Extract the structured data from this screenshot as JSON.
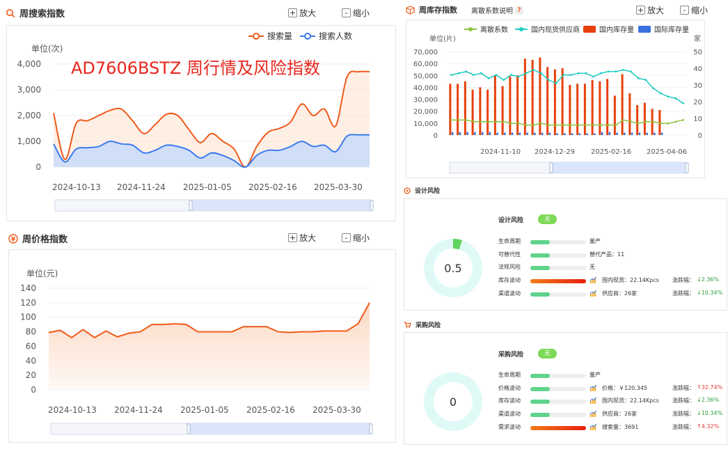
{
  "overlay_title": "AD7606BSTZ 周行情及风险指数",
  "controls": {
    "zoom_in": "放大",
    "zoom_out": "缩小",
    "plus": "+",
    "minus": "-"
  },
  "search_panel": {
    "title": "周搜索指数",
    "unit": "单位(次)",
    "legend": [
      "搜索量",
      "搜索人数"
    ],
    "y_ticks": [
      "4,000",
      "3,000",
      "2,000",
      "1,000",
      "0"
    ],
    "x_ticks": [
      "2024-10-13",
      "2024-11-24",
      "2025-01-05",
      "2025-02-16",
      "2025-03-30"
    ]
  },
  "price_panel": {
    "title": "周价格指数",
    "unit": "单位(元)",
    "y_ticks": [
      "140",
      "120",
      "100",
      "80",
      "60",
      "40",
      "20",
      "0"
    ],
    "x_ticks": [
      "2024-10-13",
      "2024-11-24",
      "2025-01-05",
      "2025-02-16",
      "2025-03-30"
    ]
  },
  "inventory_panel": {
    "title": "周库存指数",
    "help_label": "离散系数说明",
    "help_icon": "?",
    "legend": [
      "离散系数",
      "国内现货供应商",
      "国内库存量",
      "国际库存量"
    ],
    "unit_left": "单位(片)",
    "unit_right": "家",
    "y_ticks_left": [
      "70,000",
      "60,000",
      "50,000",
      "40,000",
      "30,000",
      "20,000",
      "10,000",
      "0"
    ],
    "y_ticks_right": [
      "50",
      "40",
      "30",
      "20",
      "10",
      "0"
    ],
    "x_ticks": [
      "2024-11-10",
      "2024-12-29",
      "2025-02-16",
      "2025-04-06"
    ]
  },
  "design_risk": {
    "section_title": "设计风险",
    "score": "0.5",
    "header_label": "设计风险",
    "header_badge": "无",
    "rows": [
      {
        "label": "生命周期",
        "value": "量产",
        "change_label": "",
        "change": ""
      },
      {
        "label": "可替代性",
        "value": "替代产品：11",
        "change_label": "",
        "change": ""
      },
      {
        "label": "法规风险",
        "value": "无",
        "change_label": "",
        "change": ""
      },
      {
        "label": "库存波动",
        "value": "国内现货：22.14Kpcs",
        "change_label": "涨跌幅：",
        "change": "↓2.36%"
      },
      {
        "label": "渠道波动",
        "value": "供应商：26家",
        "change_label": "涨跌幅：",
        "change": "↓10.34%"
      }
    ]
  },
  "purchase_risk": {
    "section_title": "采购风险",
    "score": "0",
    "header_label": "采购风险",
    "header_badge": "无",
    "rows": [
      {
        "label": "生命周期",
        "value": "量产",
        "change_label": "",
        "change": ""
      },
      {
        "label": "价格波动",
        "value": "价格：￥120.345",
        "change_label": "涨跌幅：",
        "change": "↑32.74%"
      },
      {
        "label": "库存波动",
        "value": "国内现货：22.14Kpcs",
        "change_label": "涨跌幅：",
        "change": "↓2.36%"
      },
      {
        "label": "渠道波动",
        "value": "供应商：26家",
        "change_label": "涨跌幅：",
        "change": "↓10.34%"
      },
      {
        "label": "需求波动",
        "value": "搜索量：3691",
        "change_label": "涨跌幅：",
        "change": "↑4.32%"
      }
    ]
  },
  "colors": {
    "orange": "#f05a1a",
    "blue": "#3a7bef",
    "green": "#8cc63f",
    "teal": "#1ccbbf",
    "down": "#2e9e3e",
    "up": "#e53935",
    "title_red": "#e8261e"
  },
  "chart_data": [
    {
      "type": "line",
      "title": "周搜索指数",
      "ylabel": "单位(次)",
      "ylim": [
        0,
        4000
      ],
      "x": [
        "2024-09-29",
        "2024-10-06",
        "2024-10-13",
        "2024-10-20",
        "2024-10-27",
        "2024-11-03",
        "2024-11-10",
        "2024-11-17",
        "2024-11-24",
        "2024-12-01",
        "2024-12-08",
        "2024-12-15",
        "2024-12-22",
        "2024-12-29",
        "2025-01-05",
        "2025-01-12",
        "2025-01-19",
        "2025-01-26",
        "2025-02-02",
        "2025-02-09",
        "2025-02-16",
        "2025-02-23",
        "2025-03-02",
        "2025-03-09",
        "2025-03-16",
        "2025-03-23",
        "2025-03-30",
        "2025-04-06",
        "2025-04-13"
      ],
      "series": [
        {
          "name": "搜索量",
          "values": [
            2100,
            300,
            1700,
            1800,
            2000,
            2200,
            2250,
            1800,
            1300,
            1650,
            2050,
            2000,
            1450,
            950,
            1300,
            1000,
            700,
            0,
            800,
            1350,
            1500,
            1750,
            2450,
            2000,
            2250,
            1600,
            3500,
            3700,
            3700
          ]
        },
        {
          "name": "搜索人数",
          "values": [
            900,
            200,
            700,
            750,
            800,
            1000,
            900,
            850,
            550,
            650,
            850,
            800,
            650,
            350,
            550,
            450,
            250,
            0,
            450,
            650,
            650,
            800,
            1000,
            800,
            850,
            600,
            1200,
            1250,
            1250
          ]
        }
      ]
    },
    {
      "type": "area",
      "title": "周价格指数",
      "ylabel": "单位(元)",
      "ylim": [
        0,
        140
      ],
      "x": [
        "2024-09-29",
        "2024-10-06",
        "2024-10-13",
        "2024-10-20",
        "2024-10-27",
        "2024-11-03",
        "2024-11-10",
        "2024-11-17",
        "2024-11-24",
        "2024-12-01",
        "2024-12-08",
        "2024-12-15",
        "2024-12-22",
        "2024-12-29",
        "2025-01-05",
        "2025-01-12",
        "2025-01-19",
        "2025-01-26",
        "2025-02-02",
        "2025-02-09",
        "2025-02-16",
        "2025-02-23",
        "2025-03-02",
        "2025-03-09",
        "2025-03-16",
        "2025-03-23",
        "2025-03-30",
        "2025-04-06",
        "2025-04-13"
      ],
      "series": [
        {
          "values": [
            79,
            82,
            72,
            83,
            72,
            81,
            73,
            78,
            80,
            90,
            90,
            91,
            90,
            80,
            80,
            80,
            80,
            87,
            87,
            87,
            80,
            79,
            80,
            80,
            81,
            81,
            81,
            91,
            120
          ]
        }
      ]
    },
    {
      "type": "bar",
      "title": "周库存指数",
      "ylabel": "单位(片)",
      "ylim": [
        0,
        70000
      ],
      "y2lim": [
        0,
        50
      ],
      "x": [
        "2024-10-13",
        "2024-10-20",
        "2024-10-27",
        "2024-11-03",
        "2024-11-10",
        "2024-11-17",
        "2024-11-24",
        "2024-12-01",
        "2024-12-08",
        "2024-12-15",
        "2024-12-22",
        "2024-12-29",
        "2025-01-05",
        "2025-01-12",
        "2025-01-19",
        "2025-01-26",
        "2025-02-02",
        "2025-02-09",
        "2025-02-16",
        "2025-02-23",
        "2025-03-02",
        "2025-03-09",
        "2025-03-16",
        "2025-03-23",
        "2025-03-30",
        "2025-04-06",
        "2025-04-13",
        "2025-04-20",
        "2025-04-27",
        "2025-05-04",
        "2025-05-11",
        "2025-05-18"
      ],
      "series": [
        {
          "name": "国内库存量",
          "axis": "left",
          "values": [
            43000,
            43000,
            45000,
            38000,
            40000,
            38000,
            50000,
            41000,
            49000,
            50000,
            64000,
            63000,
            65000,
            57000,
            55000,
            56000,
            42000,
            43000,
            43000,
            46000,
            45000,
            47000,
            33000,
            51000,
            35000,
            25000,
            27000,
            22000,
            21000,
            0,
            0,
            0
          ]
        },
        {
          "name": "国际库存量",
          "axis": "left",
          "values": [
            2500,
            2500,
            2500,
            2500,
            2500,
            2500,
            2000,
            2000,
            2000,
            2000,
            2000,
            2000,
            2000,
            2000,
            1500,
            1500,
            1500,
            1500,
            1500,
            1500,
            2500,
            2500,
            2000,
            2000,
            2000,
            2000,
            2000,
            2000,
            2000,
            0,
            0,
            0
          ]
        },
        {
          "name": "离散系数",
          "axis": "right",
          "values": [
            9,
            9,
            9,
            8,
            8,
            8,
            8,
            8,
            7,
            7,
            6,
            6,
            7,
            6,
            6,
            6,
            6,
            6,
            6,
            6,
            6,
            6,
            6,
            9,
            8,
            7,
            8,
            8,
            7,
            7,
            8,
            9
          ]
        },
        {
          "name": "国内现货供应商",
          "axis": "right",
          "values": [
            36,
            37,
            38,
            36,
            37,
            34,
            36,
            33,
            36,
            35,
            37,
            39,
            37,
            33,
            31,
            36,
            36,
            37,
            37,
            35,
            37,
            38,
            38,
            39,
            38,
            34,
            33,
            28,
            25,
            23,
            22,
            19
          ]
        }
      ]
    }
  ]
}
